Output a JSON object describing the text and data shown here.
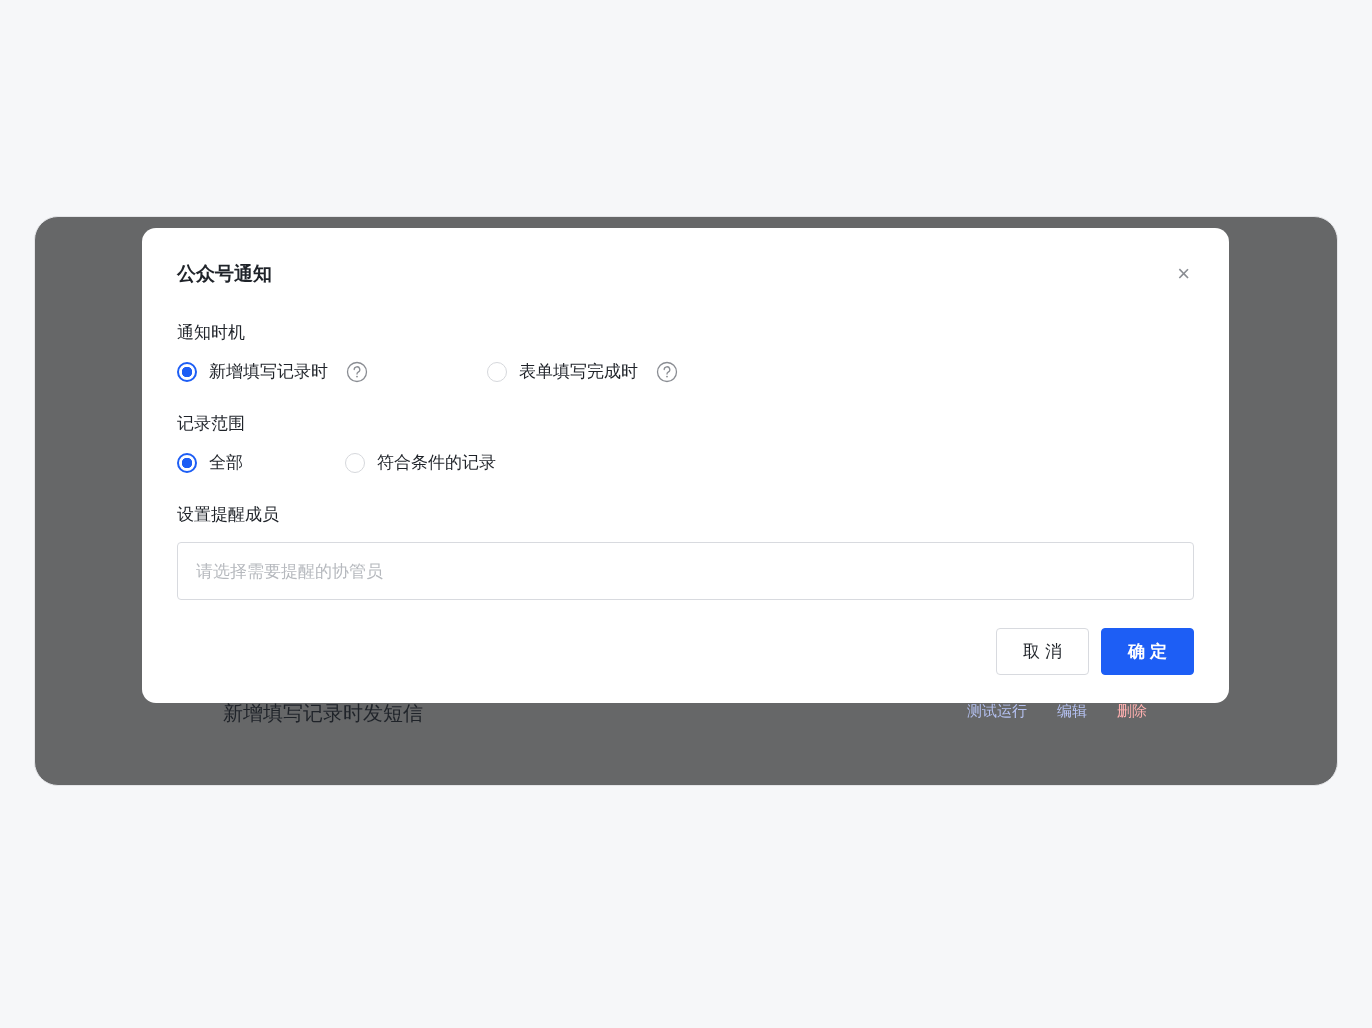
{
  "dialog": {
    "title": "公众号通知",
    "close": "×",
    "sections": [
      {
        "label": "通知时机",
        "kind": "radio",
        "options": [
          {
            "label": "新增填写记录时",
            "selected": true,
            "help": true
          },
          {
            "label": "表单填写完成时",
            "selected": false,
            "help": true
          }
        ]
      },
      {
        "label": "记录范围",
        "kind": "radio",
        "options": [
          {
            "label": "全部",
            "selected": true,
            "help": false
          },
          {
            "label": "符合条件的记录",
            "selected": false,
            "help": false
          }
        ]
      },
      {
        "label": "设置提醒成员",
        "kind": "select",
        "placeholder": "请选择需要提醒的协管员"
      }
    ],
    "buttons": [
      {
        "label": "取 消",
        "kind": "secondary"
      },
      {
        "label": "确 定",
        "kind": "primary"
      }
    ]
  },
  "background_row": {
    "title": "新增填写记录时发短信",
    "actions": [
      {
        "label": "测试运行",
        "kind": "normal"
      },
      {
        "label": "编辑",
        "kind": "normal"
      },
      {
        "label": "删除",
        "kind": "danger"
      }
    ]
  }
}
